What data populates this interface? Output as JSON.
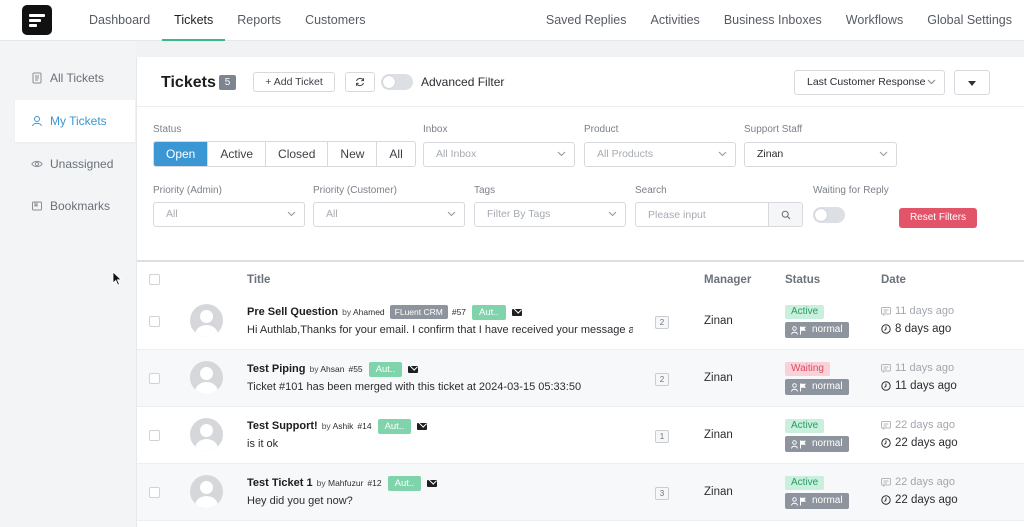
{
  "topnav": {
    "left": [
      "Dashboard",
      "Tickets",
      "Reports",
      "Customers"
    ],
    "right": [
      "Saved Replies",
      "Activities",
      "Business Inboxes",
      "Workflows",
      "Global Settings"
    ],
    "active": "Tickets"
  },
  "sidebar": {
    "items": [
      {
        "label": "All Tickets",
        "icon": "document-icon"
      },
      {
        "label": "My Tickets",
        "icon": "user-icon"
      },
      {
        "label": "Unassigned",
        "icon": "eye-icon"
      },
      {
        "label": "Bookmarks",
        "icon": "bookmark-icon"
      }
    ],
    "active": "My Tickets"
  },
  "header": {
    "title": "Tickets",
    "count": "5",
    "add_ticket": "+ Add Ticket",
    "advanced_filter": "Advanced Filter",
    "sort_by": "Last Customer Response"
  },
  "filters": {
    "status_label": "Status",
    "status_options": [
      "Open",
      "Active",
      "Closed",
      "New",
      "All"
    ],
    "status_selected": "Open",
    "inbox_label": "Inbox",
    "inbox_placeholder": "All Inbox",
    "product_label": "Product",
    "product_placeholder": "All Products",
    "staff_label": "Support Staff",
    "staff_value": "Zinan",
    "priority_admin_label": "Priority (Admin)",
    "priority_admin_value": "All",
    "priority_customer_label": "Priority (Customer)",
    "priority_customer_value": "All",
    "tags_label": "Tags",
    "tags_placeholder": "Filter By Tags",
    "search_label": "Search",
    "search_placeholder": "Please input",
    "waiting_label": "Waiting for Reply",
    "reset": "Reset Filters"
  },
  "table": {
    "columns": [
      "Title",
      "Manager",
      "Status",
      "Date"
    ],
    "rows": [
      {
        "title": "Pre Sell Question",
        "by": "by",
        "author": "Ahamed",
        "crm": "FLuent CRM",
        "num": "#57",
        "tag": "Aut..",
        "excerpt": "Hi Authlab,Thanks for your email. I confirm that I have received your message a",
        "replies": "2",
        "manager": "Zinan",
        "status": "Active",
        "priority": "normal",
        "date1": "11 days ago",
        "date2": "8 days ago"
      },
      {
        "title": "Test Piping",
        "by": "by",
        "author": "Ahsan",
        "crm": "",
        "num": "#55",
        "tag": "Aut..",
        "excerpt": "Ticket #101 has been merged with this ticket at 2024-03-15 05:33:50",
        "replies": "2",
        "manager": "Zinan",
        "status": "Waiting",
        "priority": "normal",
        "date1": "11 days ago",
        "date2": "11 days ago"
      },
      {
        "title": "Test Support!",
        "by": "by",
        "author": "Ashik",
        "crm": "",
        "num": "#14",
        "tag": "Aut..",
        "excerpt": "is it ok",
        "replies": "1",
        "manager": "Zinan",
        "status": "Active",
        "priority": "normal",
        "date1": "22 days ago",
        "date2": "22 days ago"
      },
      {
        "title": "Test Ticket 1",
        "by": "by",
        "author": "Mahfuzur",
        "crm": "",
        "num": "#12",
        "tag": "Aut..",
        "excerpt": "Hey did you get now?",
        "replies": "3",
        "manager": "Zinan",
        "status": "Active",
        "priority": "normal",
        "date1": "22 days ago",
        "date2": "22 days ago"
      }
    ]
  },
  "colors": {
    "accent": "#3a97d4",
    "nav_underline": "#3ab88c",
    "danger": "#e25468",
    "tag_green": "#7fd4ac",
    "badge_gray": "#8d949d"
  }
}
